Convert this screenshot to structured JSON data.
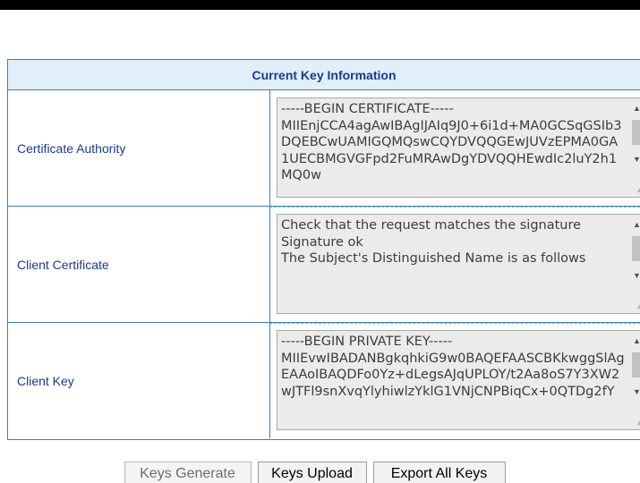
{
  "panel": {
    "header": "Current Key Information",
    "rows": [
      {
        "label": "Certificate Authority",
        "content": "-----BEGIN CERTIFICATE-----\nMIIEnjCCA4agAwIBAgIJAIq9J0+6i1d+MA0GCSqGSIb3DQEBCwUAMIGQMQswCQYDVQQGEwJUVzEPMA0GA1UECBMGVGFpd2FuMRAwDgYDVQQHEwdIc2luY2h1MQ0w"
      },
      {
        "label": "Client Certificate",
        "content": "Check that the request matches the signature\nSignature ok\nThe Subject's Distinguished Name is as follows"
      },
      {
        "label": "Client Key",
        "content": "-----BEGIN PRIVATE KEY-----\nMIIEvwIBADANBgkqhkiG9w0BAQEFAASCBKkwggSlAgEAAoIBAQDFo0Yz+dLegsAJqUPLOY/t2Aa8oS7Y3XW2wJTFl9snXvqYlyhiwlzYklG1VNjCNPBiqCx+0QTDg2fY"
      }
    ]
  },
  "buttons": {
    "generate": "Keys Generate",
    "upload": "Keys Upload",
    "export": "Export All Keys"
  },
  "colors": {
    "header_bg": "#e1effb",
    "border": "#3a7cc4",
    "label_text": "#1a3a8f",
    "textarea_bg": "#ebebeb"
  }
}
